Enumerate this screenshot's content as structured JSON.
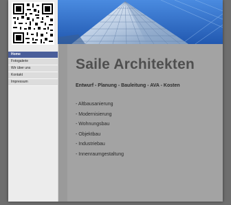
{
  "nav": {
    "items": [
      {
        "label": "Home",
        "active": true
      },
      {
        "label": "Fotogalerie",
        "active": false
      },
      {
        "label": "Wir über uns",
        "active": false
      },
      {
        "label": "Kontakt",
        "active": false
      },
      {
        "label": "Impressum",
        "active": false
      }
    ]
  },
  "main": {
    "title": "Saile Architekten",
    "subtitle": "Entwurf - Planung - Bauleitung - AVA - Kosten",
    "services": [
      "- Altbausanierung",
      "- Modernisierung",
      "- Wohnungsbau",
      "- Objektbau",
      "- Industriebau",
      "- Innenraumgestaltung"
    ]
  },
  "colors": {
    "page_bg": "#6e6e6e",
    "nav_active": "#4a5e9a",
    "banner_sky": "#2a64b8",
    "title": "#4f4f4f"
  }
}
